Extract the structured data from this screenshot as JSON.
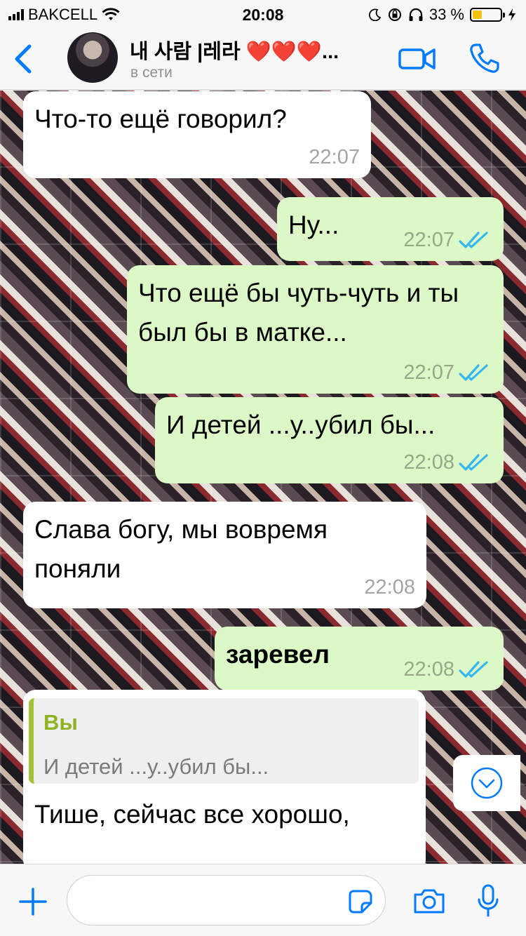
{
  "status_bar": {
    "carrier": "BAKCELL",
    "time": "20:08",
    "battery": "33 %",
    "battery_level": 0.33
  },
  "header": {
    "contact_name": "내 사람 |레라 ❤️❤️❤️...",
    "contact_status": "в сети",
    "icons": [
      "back-icon",
      "video-call-icon",
      "voice-call-icon"
    ]
  },
  "messages": [
    {
      "dir": "in",
      "text": "Что-то ещё говорил?",
      "time": "22:07"
    },
    {
      "dir": "out",
      "text": "Ну...",
      "time": "22:07",
      "read": true
    },
    {
      "dir": "out",
      "text": "Что ещё бы чуть-чуть и ты  был бы в матке...",
      "time": "22:07",
      "read": true
    },
    {
      "dir": "out",
      "text": "И детей ...у..убил бы...",
      "time": "22:08",
      "read": true
    },
    {
      "dir": "in",
      "text": "Слава богу, мы вовремя поняли",
      "time": "22:08"
    },
    {
      "dir": "out",
      "text": "заревел",
      "time": "22:08",
      "read": true,
      "bold": true
    },
    {
      "dir": "in",
      "reply_sender": "Вы",
      "reply_text": "И детей ...у..убил бы...",
      "text": "Тише, сейчас все хорошо,"
    }
  ],
  "input": {
    "placeholder": "",
    "value": "",
    "icons": [
      "plus-icon",
      "sticker-icon",
      "camera-icon",
      "microphone-icon"
    ]
  },
  "colors": {
    "accent": "#007aff",
    "outgoing_bubble": "#dcf8c6",
    "incoming_bubble": "#ffffff",
    "read_ticks": "#34b7f1",
    "reply_sender": "#8fb321"
  }
}
